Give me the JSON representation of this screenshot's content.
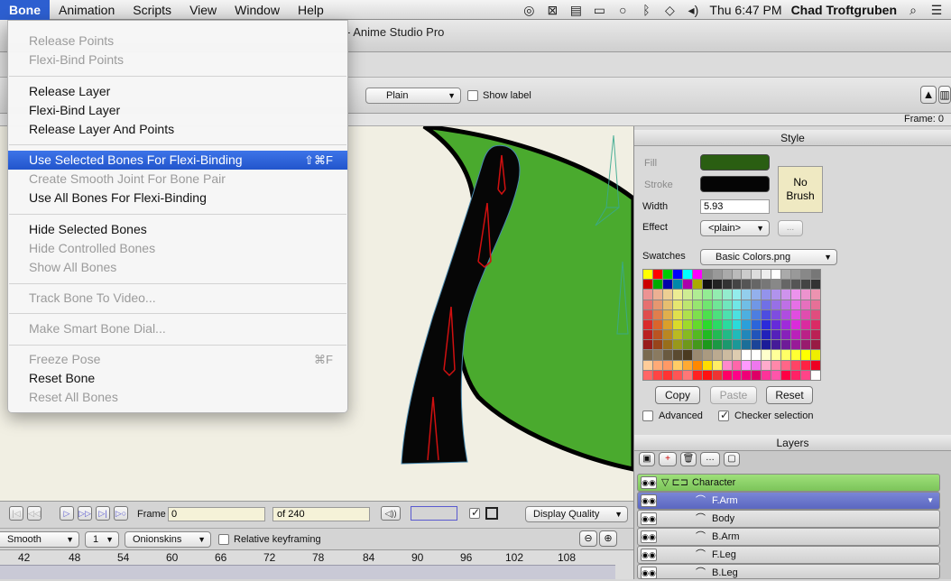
{
  "menubar": {
    "items": [
      "Bone",
      "Animation",
      "Scripts",
      "View",
      "Window",
      "Help"
    ],
    "clock": "Thu 6:47 PM",
    "user": "Chad Troftgruben"
  },
  "window": {
    "title": "- Anime Studio Pro"
  },
  "tool_options": {
    "label_style": "Plain",
    "show_label": "Show label"
  },
  "frame_indicator": "Frame: 0",
  "bone_menu": {
    "items": [
      {
        "label": "Release Points",
        "enabled": false
      },
      {
        "label": "Flexi-Bind Points",
        "enabled": false
      },
      {
        "label": "Release Layer",
        "enabled": true
      },
      {
        "label": "Flexi-Bind Layer",
        "enabled": true
      },
      {
        "label": "Release Layer And Points",
        "enabled": true
      },
      {
        "label": "Use Selected Bones For Flexi-Binding",
        "enabled": true,
        "shortcut": "⇧⌘F",
        "highlighted": true
      },
      {
        "label": "Create Smooth Joint For Bone Pair",
        "enabled": false
      },
      {
        "label": "Use All Bones For Flexi-Binding",
        "enabled": true
      },
      {
        "label": "Hide Selected Bones",
        "enabled": true
      },
      {
        "label": "Hide Controlled Bones",
        "enabled": false
      },
      {
        "label": "Show All Bones",
        "enabled": false
      },
      {
        "label": "Track Bone To Video...",
        "enabled": false
      },
      {
        "label": "Make Smart Bone Dial...",
        "enabled": false
      },
      {
        "label": "Freeze Pose",
        "enabled": false,
        "shortcut": "⌘F"
      },
      {
        "label": "Reset Bone",
        "enabled": true
      },
      {
        "label": "Reset All Bones",
        "enabled": false
      }
    ]
  },
  "style_panel": {
    "header": "Style",
    "fill_label": "Fill",
    "stroke_label": "Stroke",
    "fill_color": "#2a5e12",
    "stroke_color": "#050505",
    "brush_label": "No Brush",
    "width_label": "Width",
    "width_value": "5.93",
    "effect_label": "Effect",
    "effect_value": "<plain>",
    "effect_extra": "...",
    "swatches_label": "Swatches",
    "swatches_value": "Basic Colors.png",
    "copy": "Copy",
    "paste": "Paste",
    "reset": "Reset",
    "advanced": "Advanced",
    "checker": "Checker selection"
  },
  "layers_panel": {
    "header": "Layers",
    "layers": [
      {
        "name": "Character",
        "type": "group"
      },
      {
        "name": "F.Arm",
        "type": "bone-child",
        "selected": true
      },
      {
        "name": "Body",
        "type": "bone-child"
      },
      {
        "name": "B.Arm",
        "type": "bone-child"
      },
      {
        "name": "F.Leg",
        "type": "bone-child"
      },
      {
        "name": "B.Leg",
        "type": "bone-child"
      }
    ]
  },
  "playback": {
    "frame_label": "Frame",
    "frame_value": "0",
    "of_label": "of",
    "total_frames": "240",
    "display_quality": "Display Quality"
  },
  "timeline": {
    "interp": "Smooth",
    "step": "1",
    "onionskins": "Onionskins",
    "relative": "Relative keyframing",
    "ticks": [
      "42",
      "48",
      "54",
      "60",
      "66",
      "72",
      "78",
      "84",
      "90",
      "96",
      "102",
      "108"
    ]
  }
}
